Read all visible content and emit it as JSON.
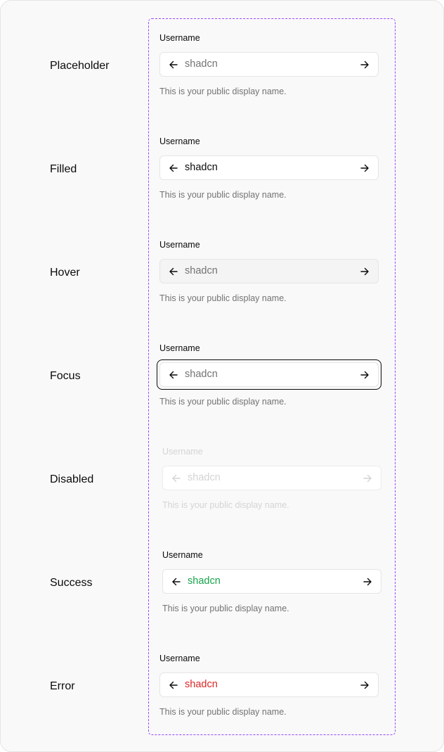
{
  "states": [
    {
      "name": "Placeholder",
      "label": "Username",
      "value": "shadcn",
      "help": "This is your public display name."
    },
    {
      "name": "Filled",
      "label": "Username",
      "value": "shadcn",
      "help": "This is your public display name."
    },
    {
      "name": "Hover",
      "label": "Username",
      "value": "shadcn",
      "help": "This is your public display name."
    },
    {
      "name": "Focus",
      "label": "Username",
      "value": "shadcn",
      "help": "This is your public display name."
    },
    {
      "name": "Disabled",
      "label": "Username",
      "value": "shadcn",
      "help": "This is your public display name."
    },
    {
      "name": "Success",
      "label": "Username",
      "value": "shadcn",
      "help": "This is your public display name."
    },
    {
      "name": "Error",
      "label": "Username",
      "value": "shadcn",
      "help": "This is your public display name."
    }
  ],
  "icons": {
    "left": "arrow-left-icon",
    "right": "arrow-right-icon"
  },
  "colors": {
    "frame_border": "#9747ff",
    "success": "#16a34a",
    "error": "#dc2626",
    "muted": "#737373"
  }
}
